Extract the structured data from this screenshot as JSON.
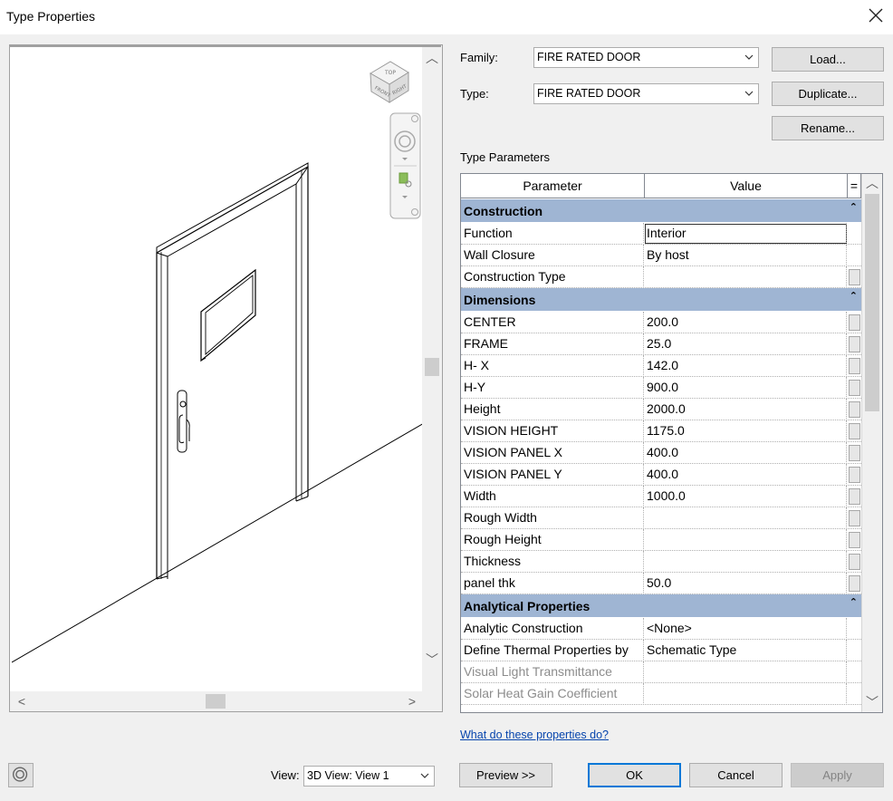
{
  "window": {
    "title": "Type Properties"
  },
  "preview": {
    "viewcube_top_label": "TOP",
    "viewcube_front_label": "FRONT",
    "viewcube_right_label": "RIGHT"
  },
  "family": {
    "label": "Family:",
    "value": "FIRE RATED DOOR"
  },
  "type": {
    "label": "Type:",
    "value": "FIRE RATED DOOR"
  },
  "buttons": {
    "load": "Load...",
    "duplicate": "Duplicate...",
    "rename": "Rename...",
    "preview": "Preview >>",
    "ok": "OK",
    "cancel": "Cancel",
    "apply": "Apply"
  },
  "type_parameters": {
    "section_label": "Type Parameters",
    "col_parameter": "Parameter",
    "col_value": "Value",
    "col_eq": "=",
    "groups": [
      {
        "name": "Construction",
        "rows": [
          {
            "parameter": "Function",
            "value": "Interior"
          },
          {
            "parameter": "Wall Closure",
            "value": "By host"
          },
          {
            "parameter": "Construction Type",
            "value": ""
          }
        ]
      },
      {
        "name": "Dimensions",
        "rows": [
          {
            "parameter": "CENTER",
            "value": "200.0"
          },
          {
            "parameter": "FRAME",
            "value": "25.0"
          },
          {
            "parameter": "H- X",
            "value": "142.0"
          },
          {
            "parameter": "H-Y",
            "value": "900.0"
          },
          {
            "parameter": "Height",
            "value": "2000.0"
          },
          {
            "parameter": "VISION HEIGHT",
            "value": "1175.0"
          },
          {
            "parameter": "VISION PANEL X",
            "value": "400.0"
          },
          {
            "parameter": "VISION PANEL Y",
            "value": "400.0"
          },
          {
            "parameter": "Width",
            "value": "1000.0"
          },
          {
            "parameter": "Rough Width",
            "value": ""
          },
          {
            "parameter": "Rough Height",
            "value": ""
          },
          {
            "parameter": "Thickness",
            "value": ""
          },
          {
            "parameter": "panel thk",
            "value": "50.0"
          }
        ]
      },
      {
        "name": "Analytical Properties",
        "rows": [
          {
            "parameter": "Analytic Construction",
            "value": "<None>"
          },
          {
            "parameter": "Define Thermal Properties by",
            "value": "Schematic Type"
          },
          {
            "parameter": "Visual Light Transmittance",
            "value": ""
          },
          {
            "parameter": "Solar Heat Gain Coefficient",
            "value": ""
          }
        ]
      }
    ]
  },
  "help_link": "What do these properties do?",
  "view": {
    "label": "View:",
    "value": "3D View: View 1"
  }
}
